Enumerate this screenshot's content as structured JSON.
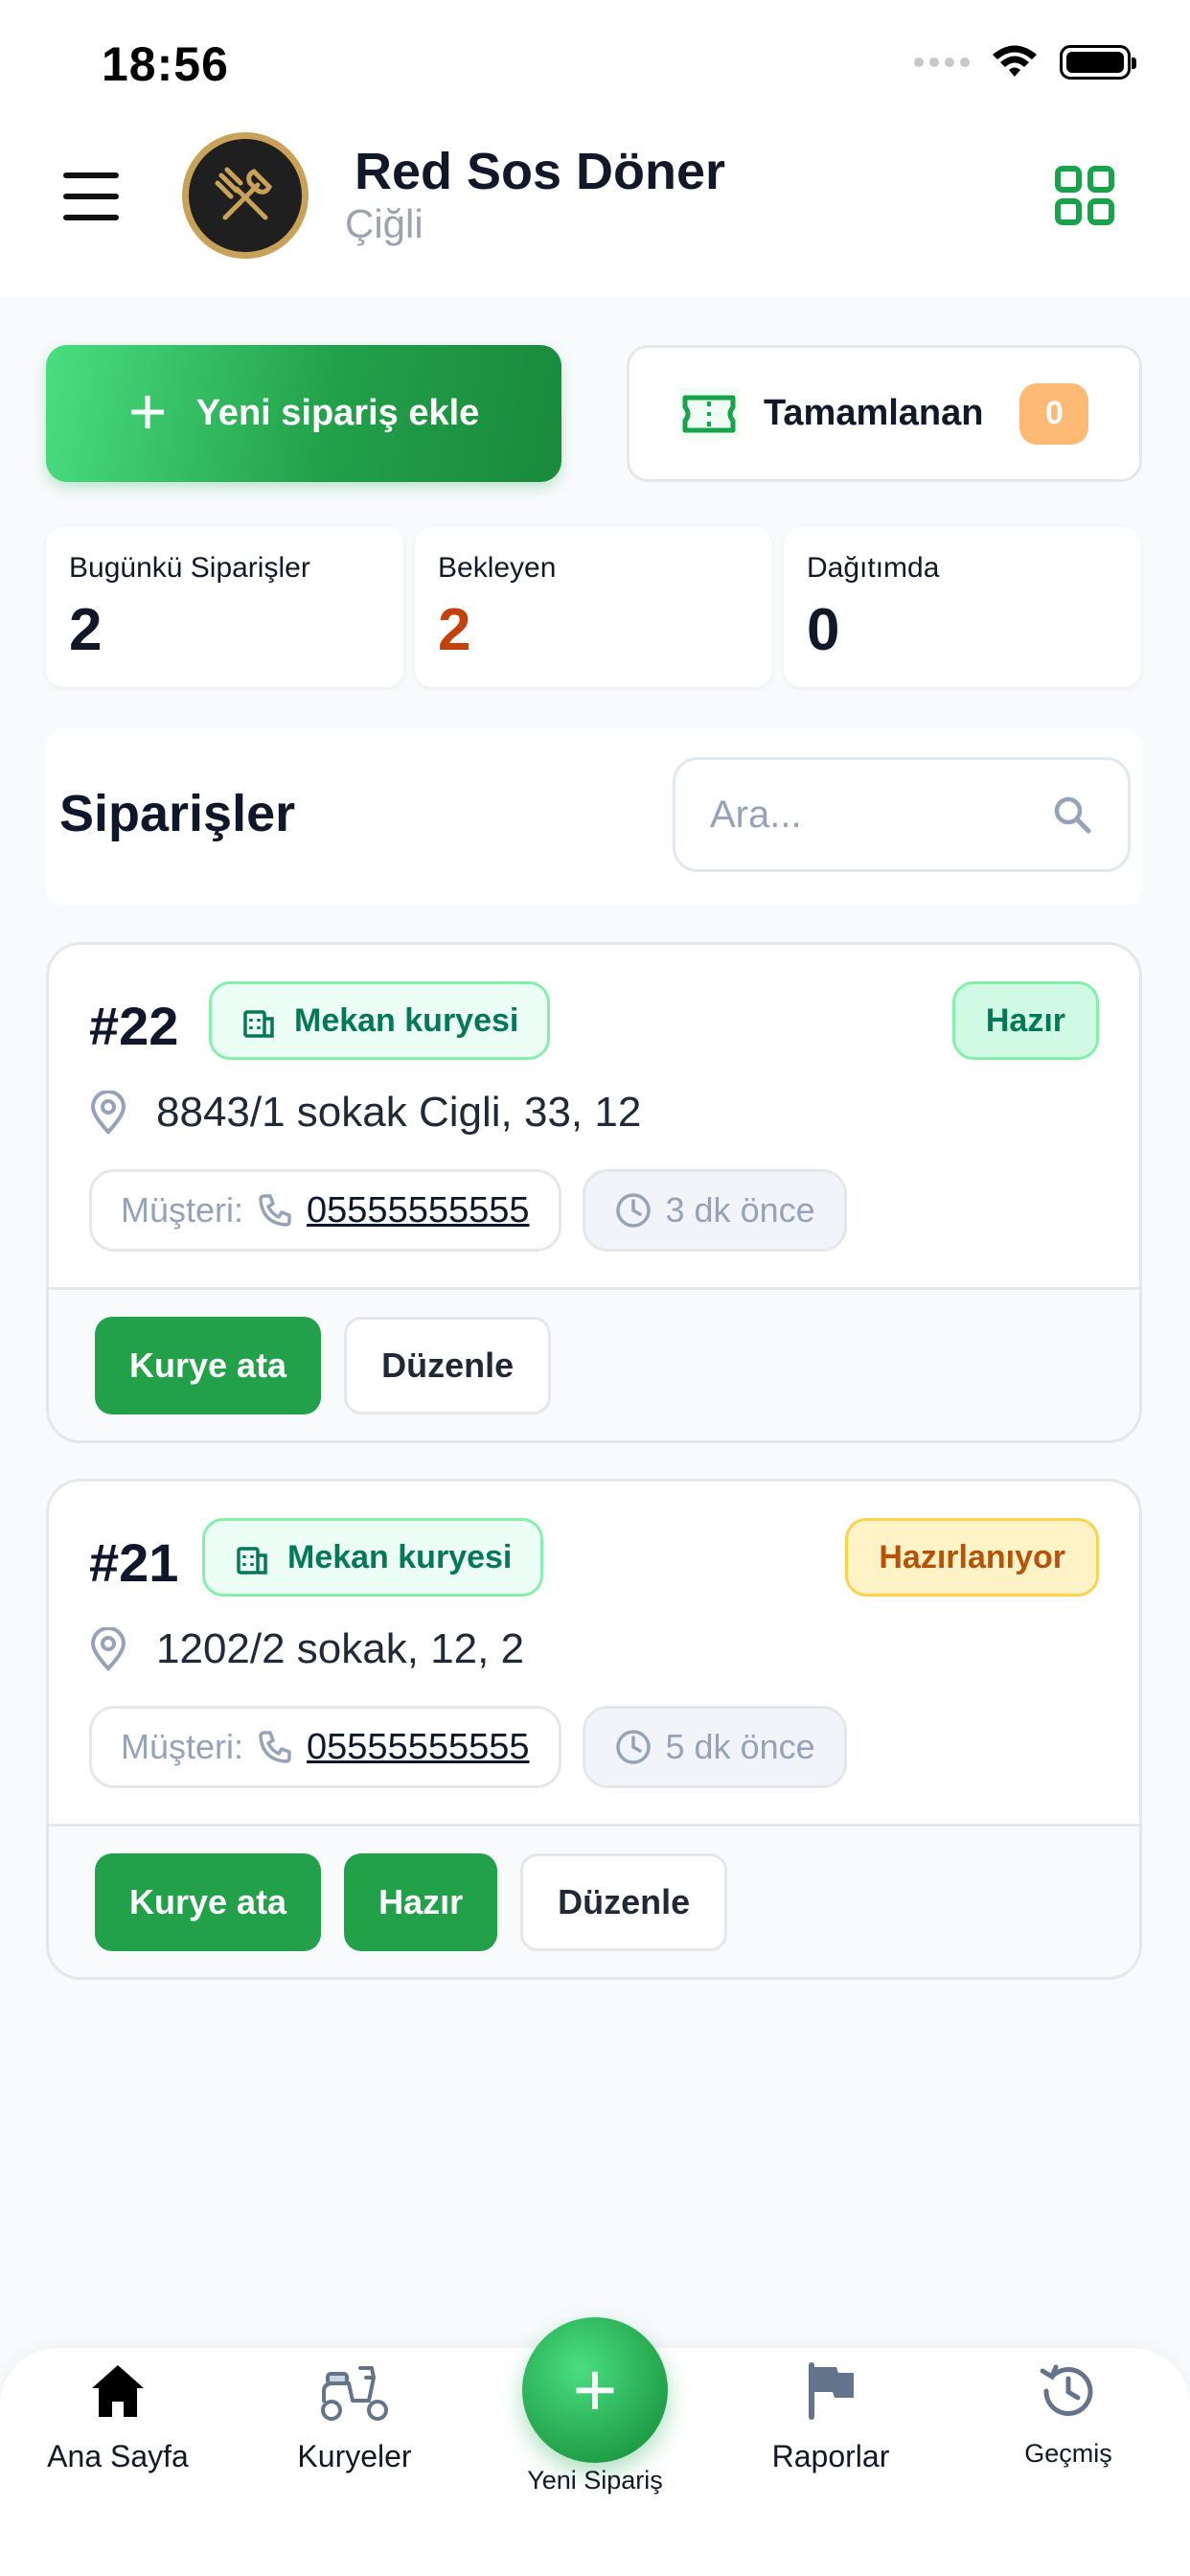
{
  "status_bar": {
    "time": "18:56"
  },
  "header": {
    "brand_name": "Red Sos Döner",
    "brand_sub": "Çiğli",
    "icons": [
      "menu-icon",
      "utensils-icon",
      "grid-icon"
    ]
  },
  "actions": {
    "new_order_label": "Yeni sipariş ekle",
    "completed_label": "Tamamlanan",
    "completed_count": "0"
  },
  "stats": [
    {
      "label": "Bugünkü Siparişler",
      "value": "2",
      "color": "#111827"
    },
    {
      "label": "Bekleyen",
      "value": "2",
      "color": "#c2410c"
    },
    {
      "label": "Dağıtımda",
      "value": "0",
      "color": "#111827"
    }
  ],
  "orders": {
    "title": "Siparişler",
    "search_placeholder": "Ara...",
    "items": [
      {
        "number": "#22",
        "courier_type": "Mekan kuryesi",
        "status": "Hazır",
        "address": "8843/1 sokak Cigli, 33, 12",
        "customer_label": "Müşteri:",
        "phone": "05555555555",
        "time_ago": "3 dk önce",
        "buttons": [
          "Kurye ata",
          "Düzenle"
        ]
      },
      {
        "number": "#21",
        "courier_type": "Mekan kuryesi",
        "status": "Hazırlanıyor",
        "address": "1202/2 sokak, 12, 2",
        "customer_label": "Müşteri:",
        "phone": "05555555555",
        "time_ago": "5 dk önce",
        "buttons": [
          "Kurye ata",
          "Hazır",
          "Düzenle"
        ]
      }
    ]
  },
  "bottom_nav": {
    "items": [
      {
        "label": "Ana Sayfa",
        "icon": "home-icon"
      },
      {
        "label": "Kuryeler",
        "icon": "scooter-icon"
      },
      {
        "label": "Yeni Sipariş",
        "icon": "plus-icon"
      },
      {
        "label": "Raporlar",
        "icon": "flag-icon"
      },
      {
        "label": "Geçmiş",
        "icon": "history-icon"
      }
    ]
  },
  "colors": {
    "accent_green": "#22a04a",
    "pending_orange": "#c2410c",
    "ready_badge": "#d1fae5",
    "preparing_badge": "#fef3c7",
    "count_badge": "#fdba74"
  }
}
